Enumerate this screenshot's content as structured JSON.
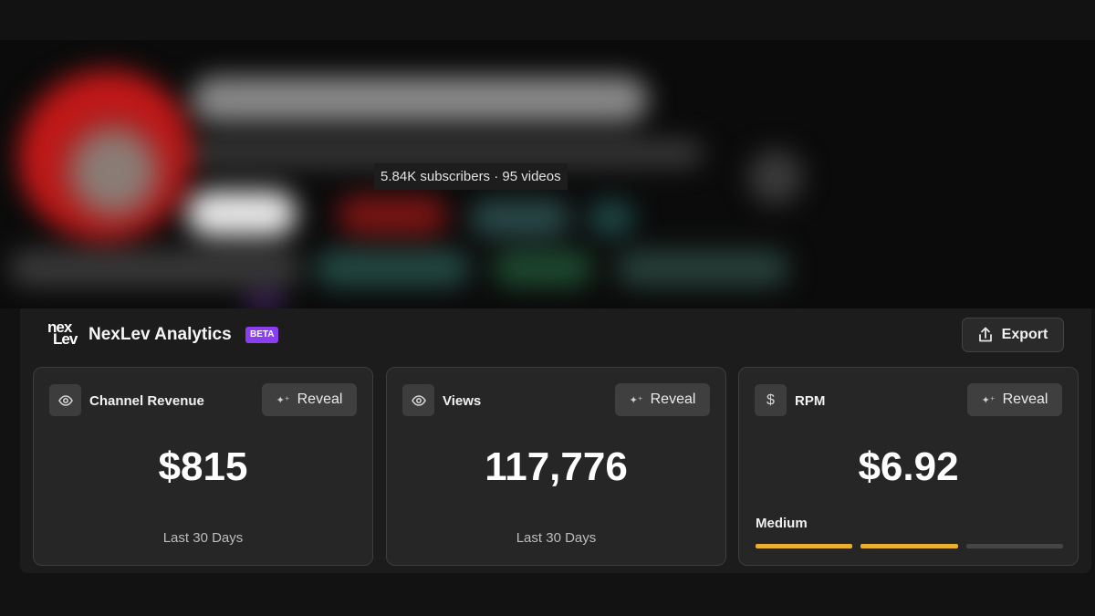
{
  "channel": {
    "subscriber_info": "5.84K subscribers · 95 videos"
  },
  "analytics": {
    "brand_logo_text": "nexLev",
    "brand_name": "NexLev Analytics",
    "badge": "BETA",
    "export_label": "Export",
    "cards": [
      {
        "icon": "eye-icon",
        "title": "Channel Revenue",
        "reveal_label": "Reveal",
        "value": "$815",
        "period": "Last 30 Days"
      },
      {
        "icon": "eye-icon",
        "title": "Views",
        "reveal_label": "Reveal",
        "value": "117,776",
        "period": "Last 30 Days"
      },
      {
        "icon": "dollar-icon",
        "title": "RPM",
        "reveal_label": "Reveal",
        "value": "$6.92",
        "level_label": "Medium",
        "level_active_segments": 2,
        "level_total_segments": 3
      }
    ]
  },
  "colors": {
    "accent_beta": "#8b3ef0",
    "level_on": "#e9b030",
    "level_off": "#454545"
  }
}
